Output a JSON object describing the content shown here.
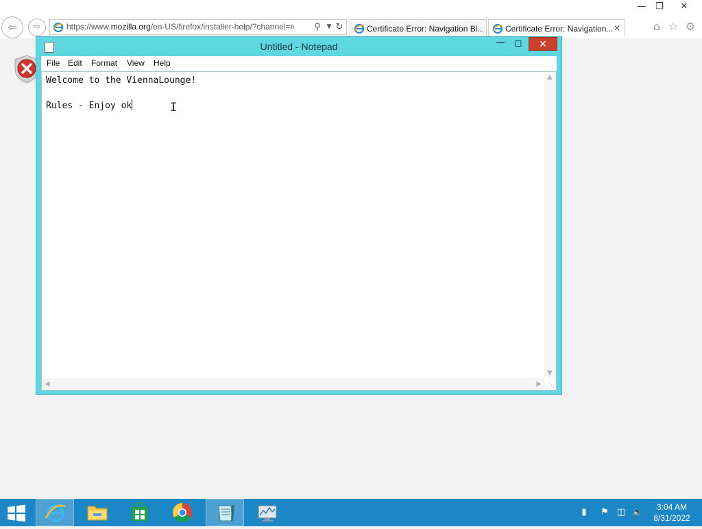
{
  "browser": {
    "url_host_prefix": "https://www.",
    "url_host": "mozilla.org",
    "url_path": "/en-US/firefox/installer-help/?channel=rele",
    "tabs": [
      {
        "title": "Certificate Error: Navigation Bl..."
      },
      {
        "title": "Certificate Error: Navigation..."
      }
    ],
    "icons": {
      "back": "back-arrow-icon",
      "forward": "forward-arrow-icon",
      "search": "search-icon",
      "dropdown": "chevron-down-icon",
      "refresh": "refresh-icon",
      "home": "home-icon",
      "favorites": "star-icon",
      "settings": "gear-icon"
    }
  },
  "notepad": {
    "title": "Untitled - Notepad",
    "menu": [
      "File",
      "Edit",
      "Format",
      "View",
      "Help"
    ],
    "lines": [
      "Welcome to the ViennaLounge!",
      "",
      "Rules - Enjoy ok"
    ],
    "accent": "#5fd7e0",
    "close_color": "#c7412d"
  },
  "taskbar": {
    "apps": [
      {
        "name": "internet-explorer",
        "active": true
      },
      {
        "name": "file-explorer",
        "active": false
      },
      {
        "name": "store",
        "active": false
      },
      {
        "name": "chrome",
        "active": false
      },
      {
        "name": "notepad",
        "active": true
      },
      {
        "name": "performance-monitor",
        "active": false
      }
    ],
    "time": "3:04 AM",
    "date": "8/31/2022",
    "color": "#1b87c6"
  }
}
